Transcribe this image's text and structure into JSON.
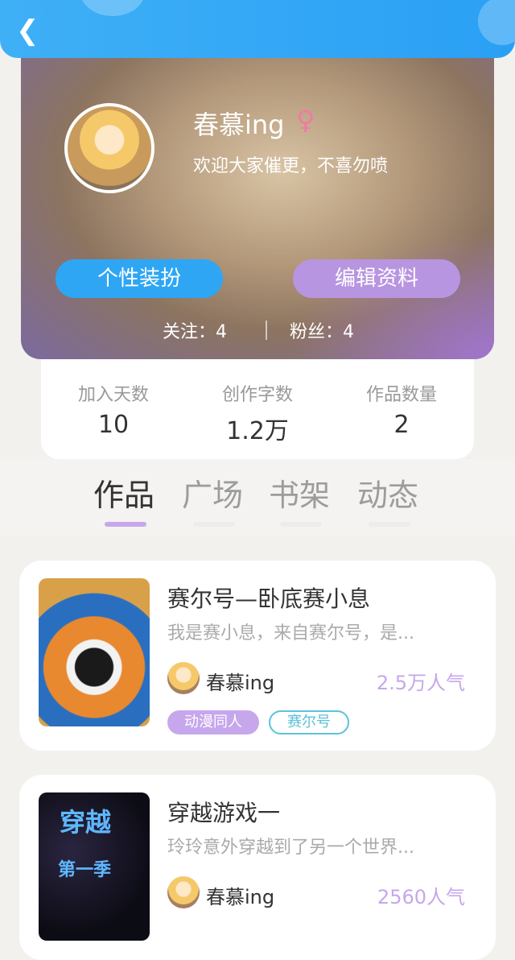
{
  "profile": {
    "nickname": "春慕ing",
    "gender_icon": "♀",
    "signature": "欢迎大家催更，不喜勿喷",
    "dress_button": "个性装扮",
    "edit_button": "编辑资料",
    "follow": "关注：4",
    "fans": "粉丝：4"
  },
  "stats": [
    {
      "label": "加入天数",
      "value": "10"
    },
    {
      "label": "创作字数",
      "value": "1.2万"
    },
    {
      "label": "作品数量",
      "value": "2"
    }
  ],
  "tabs": [
    "作品",
    "广场",
    "书架",
    "动态"
  ],
  "works": [
    {
      "title": "赛尔号—卧底赛小息",
      "desc": "我是赛小息，来自赛尔号，是...",
      "author": "春慕ing",
      "popularity": "2.5万人气",
      "tags": [
        "动漫同人",
        "赛尔号"
      ]
    },
    {
      "title": "穿越游戏一",
      "desc": "玲玲意外穿越到了另一个世界...",
      "author": "春慕ing",
      "popularity": "2560人气",
      "cover_title": "穿越",
      "cover_subtitle": "第一季"
    }
  ],
  "colors": {
    "accent_blue": "#2ea6f4",
    "accent_purple": "#c6a7ec"
  }
}
